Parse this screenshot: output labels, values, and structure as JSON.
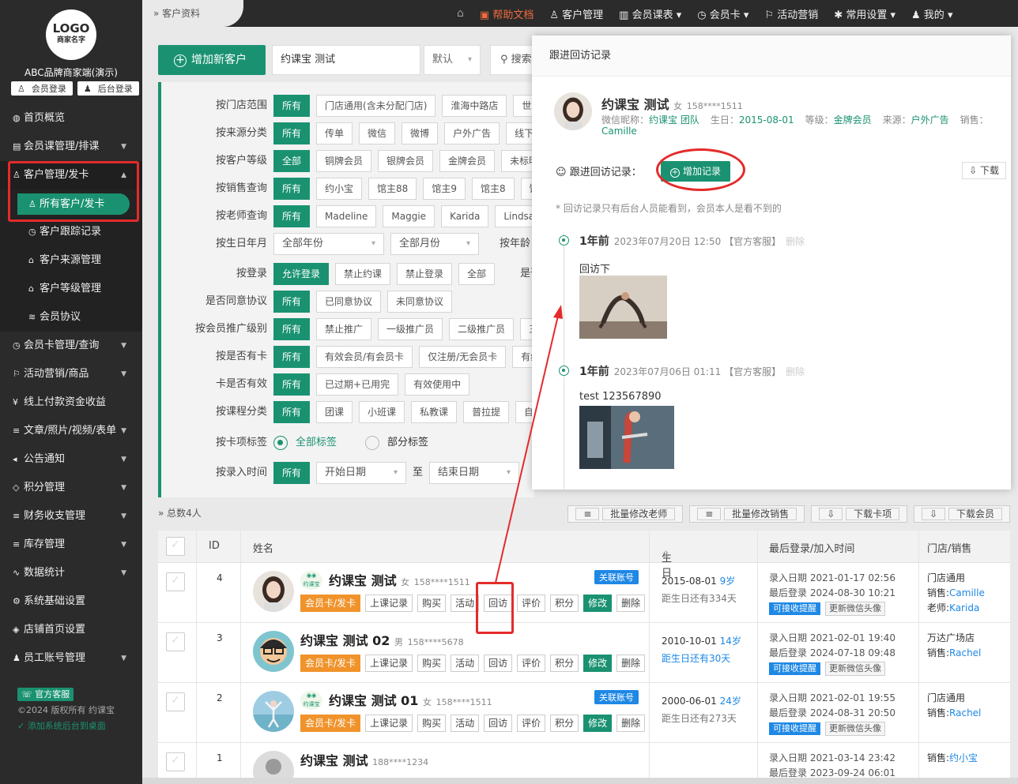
{
  "sidebar": {
    "logo_line1": "LOGO",
    "logo_line2": "商家名字",
    "brand": "ABC品牌商家端(演示)",
    "member_login": "会员登录",
    "admin_login": "后台登录",
    "items": [
      {
        "label": "首页概览",
        "icon": "◍"
      },
      {
        "label": "会员课管理/排课",
        "icon": "▤"
      },
      {
        "label": "客户管理/发卡",
        "icon": "♙"
      },
      {
        "label": "所有客户/发卡",
        "icon": "♙"
      },
      {
        "label": "客户跟踪记录",
        "icon": "◷"
      },
      {
        "label": "客户来源管理",
        "icon": "⌂"
      },
      {
        "label": "客户等级管理",
        "icon": "⌂"
      },
      {
        "label": "会员协议",
        "icon": "≋"
      },
      {
        "label": "会员卡管理/查询",
        "icon": "◷"
      },
      {
        "label": "活动营销/商品",
        "icon": "⚐"
      },
      {
        "label": "线上付款资金收益",
        "icon": "¥"
      },
      {
        "label": "文章/照片/视频/表单",
        "icon": "≡"
      },
      {
        "label": "公告通知",
        "icon": "◂"
      },
      {
        "label": "积分管理",
        "icon": "◇"
      },
      {
        "label": "财务收支管理",
        "icon": "≡"
      },
      {
        "label": "库存管理",
        "icon": "≡"
      },
      {
        "label": "数据统计",
        "icon": "∿"
      },
      {
        "label": "系统基础设置",
        "icon": "⚙"
      },
      {
        "label": "店铺首页设置",
        "icon": "◈"
      },
      {
        "label": "员工账号管理",
        "icon": "♟"
      }
    ],
    "service_badge": "官方客服",
    "copyright": "©2024 版权所有 约课宝",
    "add_desktop": "添加系统后台到桌面"
  },
  "topbar": {
    "breadcrumb": "客户资料",
    "nav": [
      "帮助文档",
      "客户管理",
      "会员课表",
      "会员卡",
      "活动营销",
      "常用设置",
      "我的"
    ]
  },
  "toolbar": {
    "add_button": "增加新客户",
    "search_value": "约课宝 测试",
    "sort_select": "默认",
    "search_button": "搜索"
  },
  "filters": [
    {
      "label": "按门店范围",
      "options": [
        "所有",
        "门店通用(含未分配门店)",
        "淮海中路店",
        "世贸"
      ]
    },
    {
      "label": "按来源分类",
      "options": [
        "所有",
        "传单",
        "微信",
        "微博",
        "户外广告",
        "线下活动"
      ]
    },
    {
      "label": "按客户等级",
      "options": [
        "全部",
        "铜牌会员",
        "银牌会员",
        "金牌会员",
        "未标明"
      ]
    },
    {
      "label": "按销售查询",
      "options": [
        "所有",
        "约小宝",
        "馆主88",
        "馆主9",
        "馆主8",
        "馆主"
      ]
    },
    {
      "label": "按老师查询",
      "options": [
        "所有",
        "Madeline",
        "Maggie",
        "Karida",
        "Lindsay"
      ]
    },
    {
      "label": "按生日年月",
      "options": [
        "全部年份",
        "全部月份"
      ],
      "extra": "按年龄"
    },
    {
      "label": "按登录",
      "options": [
        "允许登录",
        "禁止约课",
        "禁止登录",
        "全部"
      ],
      "extra": "是否"
    },
    {
      "label": "是否同意协议",
      "options": [
        "所有",
        "已同意协议",
        "未同意协议"
      ]
    },
    {
      "label": "按会员推广级别",
      "options": [
        "所有",
        "禁止推广",
        "一级推广员",
        "二级推广员",
        "三级"
      ]
    },
    {
      "label": "按是否有卡",
      "options": [
        "所有",
        "有效会员/有会员卡",
        "仅注册/无会员卡",
        "有线"
      ]
    },
    {
      "label": "卡是否有效",
      "options": [
        "所有",
        "已过期+已用完",
        "有效使用中"
      ]
    },
    {
      "label": "按课程分类",
      "options": [
        "所有",
        "团课",
        "小班课",
        "私教课",
        "普拉提",
        "自训"
      ]
    },
    {
      "label": "按卡项标签",
      "radios": [
        "全部标签",
        "部分标签"
      ]
    },
    {
      "label": "按录入时间",
      "options": [
        "所有"
      ],
      "start": "开始日期",
      "to": "至",
      "end": "结束日期"
    }
  ],
  "list": {
    "total": "总数4人",
    "bulk_actions": [
      "批量修改老师",
      "批量修改销售",
      "下载卡项",
      "下载会员"
    ],
    "headers": {
      "id": "ID",
      "name": "姓名",
      "birthday": "生日",
      "login": "最后登录/加入时间",
      "store": "门店/销售"
    },
    "actions": [
      "会员卡/发卡",
      "上课记录",
      "购买",
      "活动",
      "回访",
      "评价",
      "积分",
      "修改",
      "删除"
    ],
    "wx_badge": "约课宝",
    "link_badge": "关联账号",
    "remind_badge": "可接收提醒",
    "update_avatar": "更新微信头像",
    "rows": [
      {
        "id": "4",
        "name": "约课宝 测试",
        "gender": "女",
        "phone": "158****1511",
        "birthday": "2015-08-01",
        "age": "9岁",
        "countdown": "距生日还有334天",
        "joined": "录入日期 2021-01-17 02:56",
        "last_login": "最后登录 2024-08-30 10:21",
        "store": "门店通用",
        "sales": "销售:",
        "sales_name": "Camille",
        "teacher": "老师:",
        "teacher_name": "Karida"
      },
      {
        "id": "3",
        "name": "约课宝 测试 02",
        "gender": "男",
        "phone": "158****5678",
        "birthday": "2010-10-01",
        "age": "14岁",
        "countdown": "距生日还有30天",
        "joined": "录入日期 2021-02-01 19:40",
        "last_login": "最后登录 2024-07-18 09:48",
        "store": "万达广场店",
        "sales": "销售:",
        "sales_name": "Rachel"
      },
      {
        "id": "2",
        "name": "约课宝 测试 01",
        "gender": "女",
        "phone": "158****1511",
        "birthday": "2000-06-01",
        "age": "24岁",
        "countdown": "距生日还有273天",
        "joined": "录入日期 2021-02-01 19:55",
        "last_login": "最后登录 2024-08-31 20:50",
        "store": "门店通用",
        "sales": "销售:",
        "sales_name": "Rachel"
      },
      {
        "id": "1",
        "name": "约课宝 测试",
        "gender": "",
        "phone": "188****1234",
        "joined": "录入日期 2021-03-14 23:42",
        "last_login": "最后登录 2023-09-24 06:01",
        "sales": "销售:",
        "sales_name": "约小宝"
      }
    ]
  },
  "modal": {
    "title": "跟进回访记录",
    "name": "约课宝 测试",
    "gender": "女",
    "phone": "158****1511",
    "wechat_label": "微信昵称：",
    "wechat": "约课宝 团队",
    "birthday_label": "生日：",
    "birthday": "2015-08-01",
    "level_label": "等级：",
    "level": "金牌会员",
    "source_label": "来源：",
    "source": "户外广告",
    "sales_label": "销售：",
    "sales": "Camille",
    "records_label": "跟进回访记录：",
    "add_record": "增加记录",
    "download": "下载",
    "note": "* 回访记录只有后台人员能看到，会员本人是看不到的",
    "records": [
      {
        "ago": "1年前",
        "time": "2023年07月20日 12:50",
        "by": "【官方客服】",
        "delete": "删除",
        "text": "回访下"
      },
      {
        "ago": "1年前",
        "time": "2023年07月06日 01:11",
        "by": "【官方客服】",
        "delete": "删除",
        "text": "test 123567890"
      }
    ]
  },
  "colors": {
    "primary": "#1a9271",
    "accent_orange": "#f0932b",
    "link_blue": "#1e88e5",
    "highlight_red": "#e42b2b"
  }
}
